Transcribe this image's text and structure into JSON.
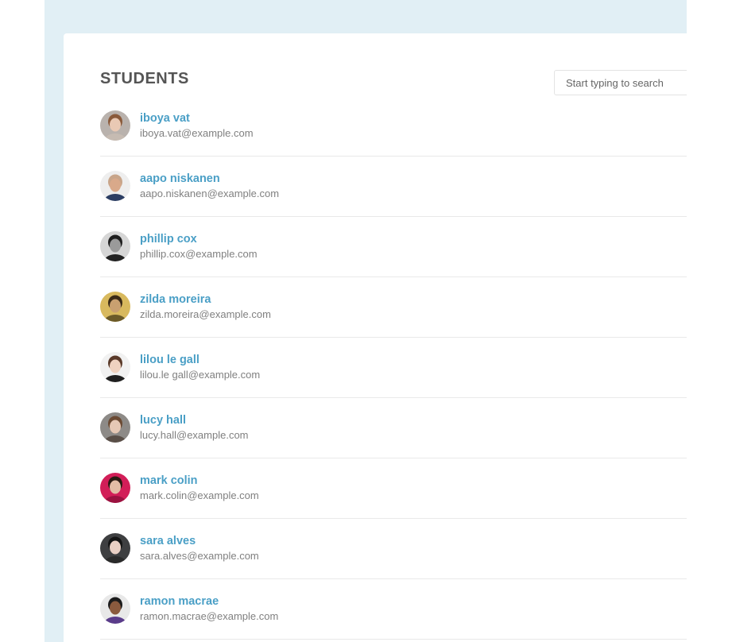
{
  "heading": "STUDENTS",
  "search": {
    "placeholder": "Start typing to search",
    "value": ""
  },
  "colors": {
    "page_background": "#e1eff5",
    "card_background": "#ffffff",
    "name_link": "#4a9fc6",
    "email_text": "#808080",
    "heading_text": "#555555"
  },
  "students": [
    {
      "name": "iboya vat",
      "email": "iboya.vat@example.com",
      "avatar": {
        "bg": "#b9b2ad",
        "hair": "#8a5a3b",
        "skin": "#e9c9b4",
        "shirt": "#c6bbb2"
      }
    },
    {
      "name": "aapo niskanen",
      "email": "aapo.niskanen@example.com",
      "avatar": {
        "bg": "#eeeeee",
        "hair": "#c8a58a",
        "skin": "#d9a98a",
        "shirt": "#2c3e63"
      }
    },
    {
      "name": "phillip cox",
      "email": "phillip.cox@example.com",
      "avatar": {
        "bg": "#d6d6d6",
        "hair": "#1f1f1f",
        "skin": "#9a9a9a",
        "shirt": "#222222"
      }
    },
    {
      "name": "zilda moreira",
      "email": "zilda.moreira@example.com",
      "avatar": {
        "bg": "#d8b95e",
        "hair": "#3a2a16",
        "skin": "#c9a070",
        "shirt": "#6b5a28"
      }
    },
    {
      "name": "lilou le gall",
      "email": "lilou.le gall@example.com",
      "avatar": {
        "bg": "#f1f1f1",
        "hair": "#5a3a2a",
        "skin": "#efd2c0",
        "shirt": "#1f1f1f"
      }
    },
    {
      "name": "lucy hall",
      "email": "lucy.hall@example.com",
      "avatar": {
        "bg": "#8d8a87",
        "hair": "#6b4a33",
        "skin": "#e6c8b5",
        "shirt": "#5a4f48"
      }
    },
    {
      "name": "mark colin",
      "email": "mark.colin@example.com",
      "avatar": {
        "bg": "#d21e58",
        "hair": "#2a1a12",
        "skin": "#e3bda6",
        "shirt": "#9b1240"
      }
    },
    {
      "name": "sara alves",
      "email": "sara.alves@example.com",
      "avatar": {
        "bg": "#3e3f41",
        "hair": "#141414",
        "skin": "#e9cfc4",
        "shirt": "#2a2a2a"
      }
    },
    {
      "name": "ramon macrae",
      "email": "ramon.macrae@example.com",
      "avatar": {
        "bg": "#e8e8e8",
        "hair": "#1c1c1c",
        "skin": "#8a5a3e",
        "shirt": "#5a3c8a"
      }
    }
  ]
}
